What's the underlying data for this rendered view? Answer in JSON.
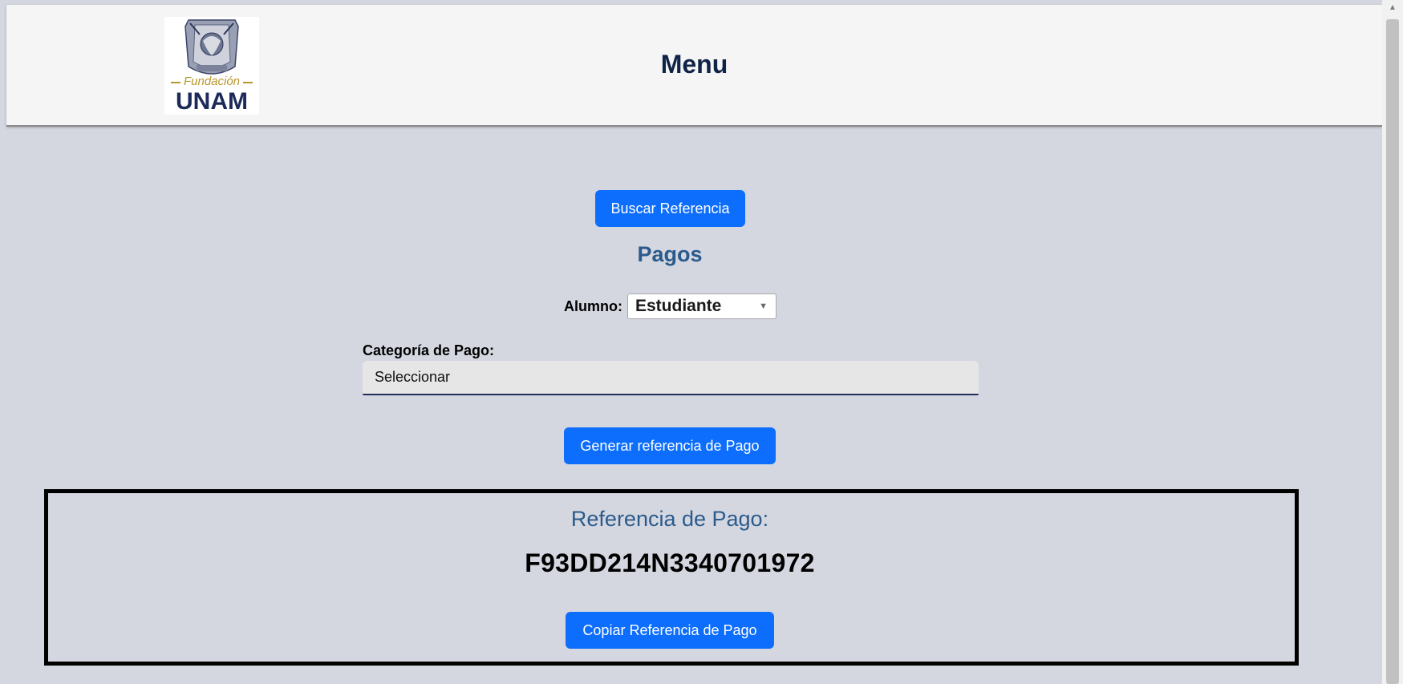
{
  "header": {
    "logo": {
      "line1": "Fundación",
      "line2": "UNAM",
      "icon": "unam-crest-icon"
    },
    "title": "Menu"
  },
  "main": {
    "buscar_button": "Buscar Referencia",
    "pagos_title": "Pagos",
    "alumno": {
      "label": "Alumno:",
      "selected": "Estudiante"
    },
    "categoria": {
      "label": "Categoría de Pago:",
      "selected": "Seleccionar"
    },
    "generar_button": "Generar referencia de Pago"
  },
  "referencia": {
    "label": "Referencia de Pago:",
    "code": "F93DD214N3340701972",
    "copiar_button": "Copiar Referencia de Pago"
  },
  "colors": {
    "background": "#d4d7e0",
    "primary_button": "#0d6efd",
    "heading": "#2b5a8c",
    "header_title": "#0f2347",
    "logo_gold": "#b8962e",
    "logo_navy": "#1c2a5a"
  }
}
